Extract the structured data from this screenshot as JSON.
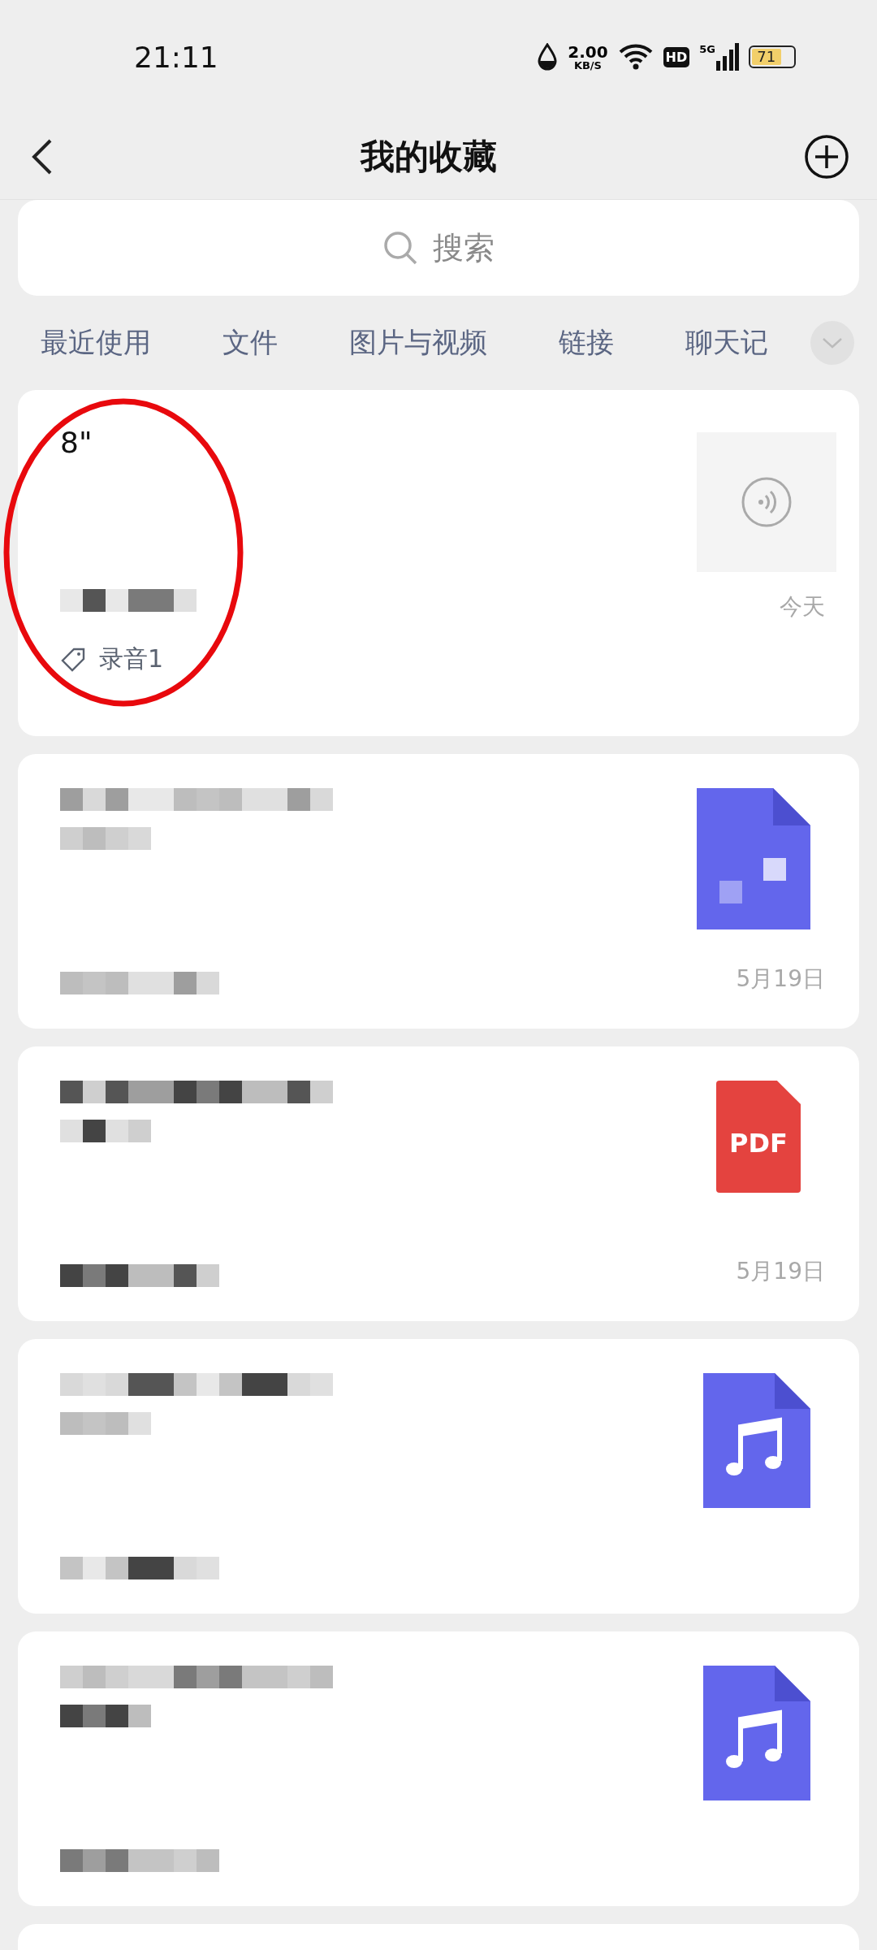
{
  "status_bar": {
    "time": "21:11",
    "speed": "2.00",
    "speed_unit": "KB/S",
    "hd": "HD",
    "network": "5G",
    "battery": "71"
  },
  "header": {
    "title": "我的收藏"
  },
  "search": {
    "placeholder": "搜索"
  },
  "tabs": [
    {
      "label": "最近使用",
      "selected": false
    },
    {
      "label": "文件",
      "selected": false
    },
    {
      "label": "图片与视频",
      "selected": false
    },
    {
      "label": "链接",
      "selected": false
    },
    {
      "label": "聊天记",
      "selected": false
    }
  ],
  "items": [
    {
      "kind": "voice",
      "title": "8\"",
      "tag": "录音1",
      "date": "今天",
      "circled": true
    },
    {
      "kind": "doc",
      "date": "5月19日",
      "circled": false
    },
    {
      "kind": "pdf",
      "badge": "PDF",
      "date": "5月19日",
      "circled": false
    },
    {
      "kind": "music",
      "circled": false
    },
    {
      "kind": "music",
      "circled": false
    },
    {
      "kind": "partial",
      "circled": false
    }
  ]
}
